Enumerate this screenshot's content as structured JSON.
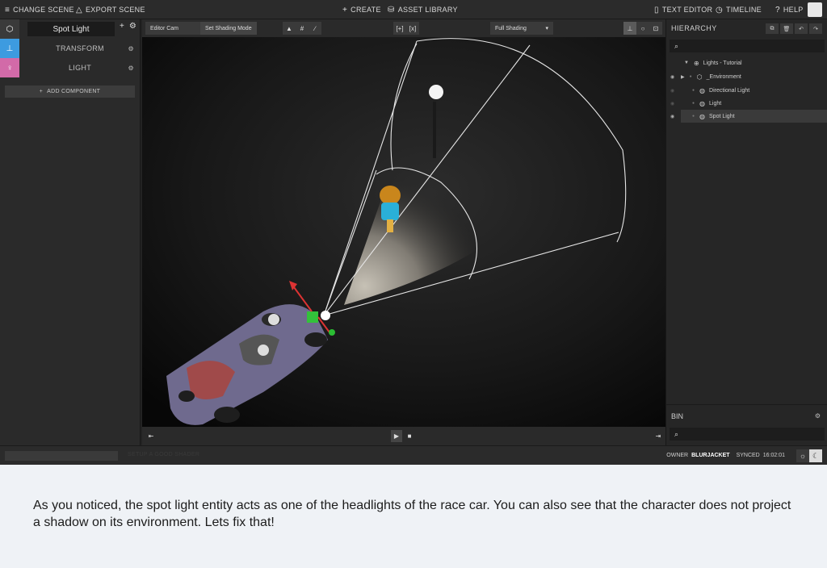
{
  "topbar": {
    "change_scene": "CHANGE SCENE",
    "export_scene": "EXPORT SCENE",
    "create": "CREATE",
    "asset_library": "ASSET LIBRARY",
    "text_editor": "TEXT EDITOR",
    "timeline": "TIMELINE",
    "help": "HELP"
  },
  "inspector": {
    "entity_name": "Spot Light",
    "components": [
      {
        "label": "TRANSFORM"
      },
      {
        "label": "LIGHT"
      }
    ],
    "add_component": "ADD COMPONENT"
  },
  "viewport_toolbar": {
    "camera": "Editor Cam",
    "shading_tooltip": "Set Shading Mode",
    "shading_mode": "Full Shading"
  },
  "hierarchy": {
    "title": "HIERARCHY",
    "items": [
      {
        "label": "Lights - Tutorial"
      },
      {
        "label": "_Environment"
      },
      {
        "label": "Directional Light"
      },
      {
        "label": "Light"
      },
      {
        "label": "Spot Light"
      }
    ]
  },
  "bin": {
    "title": "BIN"
  },
  "status": {
    "owner_label": "OWNER",
    "owner_name": "BLURJACKET",
    "synced_label": "SYNCED",
    "synced_time": "16:02:01",
    "faint_text": "SETUP A GOOD SHADER"
  },
  "caption": {
    "text": "As you noticed, the spot light entity acts as one of the headlights of the race car. You can also see that the character does not project a shadow on its environment. Lets fix that!"
  },
  "colors": {
    "transform_tab": "#3d9be0",
    "light_tab": "#d26aa8",
    "caption_bg": "#eff2f6"
  }
}
